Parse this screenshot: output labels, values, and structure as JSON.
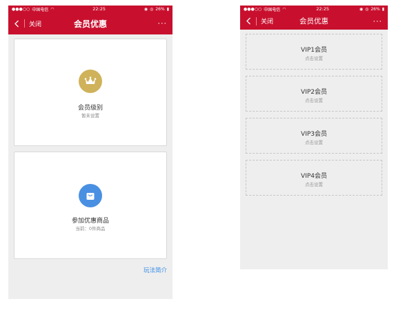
{
  "status_bar": {
    "carrier": "中国电信",
    "time": "22:25",
    "battery": "26%"
  },
  "left_screen": {
    "nav": {
      "back_label": "关闭",
      "title": "会员优惠",
      "more": "···"
    },
    "cards": [
      {
        "title": "会员级别",
        "subtitle": "暂未设置",
        "icon": "crown-icon",
        "icon_color": "#cfb25a"
      },
      {
        "title": "参加优惠商品",
        "subtitle": "当前：0件商品",
        "icon": "shopping-bag-icon",
        "icon_color": "#4a90e2"
      }
    ],
    "intro_link": "玩法简介"
  },
  "right_screen": {
    "nav": {
      "back_label": "关闭",
      "title": "会员优惠",
      "more": "···"
    },
    "vip_levels": [
      {
        "title": "VIP1会员",
        "subtitle": "点击设置"
      },
      {
        "title": "VIP2会员",
        "subtitle": "点击设置"
      },
      {
        "title": "VIP3会员",
        "subtitle": "点击设置"
      },
      {
        "title": "VIP4会员",
        "subtitle": "点击设置"
      }
    ]
  },
  "colors": {
    "brand_red": "#c8102e",
    "link_blue": "#3a8ee6",
    "background": "#eeeeee"
  }
}
